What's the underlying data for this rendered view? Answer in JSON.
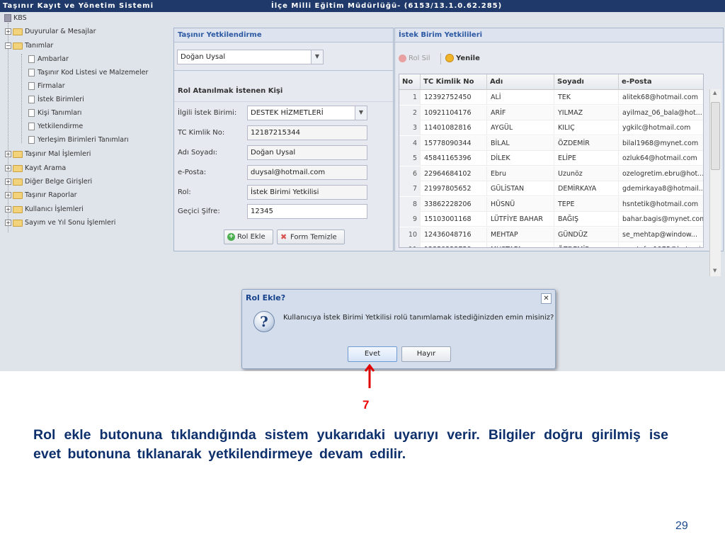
{
  "titlebar": {
    "left": "Taşınır Kayıt ve Yönetim Sistemi",
    "center": "İlçe Milli Eğitim Müdürlüğü- (6153/13.1.0.62.285)"
  },
  "tree": {
    "root": "KBS",
    "items": [
      {
        "label": "Duyurular & Mesajlar",
        "expanded": false
      },
      {
        "label": "Tanımlar",
        "expanded": true
      },
      {
        "label": "Ambarlar"
      },
      {
        "label": "Taşınır Kod Listesi ve Malzemeler"
      },
      {
        "label": "Firmalar"
      },
      {
        "label": "İstek Birimleri"
      },
      {
        "label": "Kişi Tanımları"
      },
      {
        "label": "Yetkilendirme"
      },
      {
        "label": "Yerleşim Birimleri Tanımları"
      },
      {
        "label": "Taşınır Mal İşlemleri",
        "expanded": false
      },
      {
        "label": "Kayıt Arama",
        "expanded": false
      },
      {
        "label": "Diğer Belge Girişleri",
        "expanded": false
      },
      {
        "label": "Taşınır Raporlar",
        "expanded": false
      },
      {
        "label": "Kullanıcı İşlemleri",
        "expanded": false
      },
      {
        "label": "Sayım ve Yıl Sonu İşlemleri",
        "expanded": false
      }
    ]
  },
  "left_panel": {
    "title": "Taşınır Yetkilendirme",
    "person_select": "Doğan Uysal",
    "section_title": "Rol Atanılmak İstenen Kişi",
    "fields": {
      "unit_label": "İlgili İstek Birimi:",
      "unit_value": "DESTEK HİZMETLERİ",
      "tc_label": "TC Kimlik No:",
      "tc_value": "12187215344",
      "name_label": "Adı Soyadı:",
      "name_value": "Doğan Uysal",
      "email_label": "e-Posta:",
      "email_value": "duysal@hotmail.com",
      "role_label": "Rol:",
      "role_value": "İstek Birimi Yetkilisi",
      "pass_label": "Geçici Şifre:",
      "pass_value": "12345"
    },
    "add_role_button": "Rol Ekle",
    "clear_form_button": "Form Temizle"
  },
  "right_panel": {
    "title": "İstek Birim Yetkilileri",
    "delete_role_button": "Rol Sil",
    "refresh_button": "Yenile",
    "columns": [
      "No",
      "TC Kimlik No",
      "Adı",
      "Soyadı",
      "e-Posta"
    ],
    "rows": [
      [
        "1",
        "12392752450",
        "ALİ",
        "TEK",
        "alitek68@hotmail.com"
      ],
      [
        "2",
        "10921104176",
        "ARİF",
        "YILMAZ",
        "ayilmaz_06_bala@hot..."
      ],
      [
        "3",
        "11401082816",
        "AYGÜL",
        "KILIÇ",
        "ygkilc@hotmail.com"
      ],
      [
        "4",
        "15778090344",
        "BİLAL",
        "ÖZDEMİR",
        "bilal1968@mynet.com"
      ],
      [
        "5",
        "45841165396",
        "DİLEK",
        "ELİPE",
        "ozluk64@hotmail.com"
      ],
      [
        "6",
        "22964684102",
        "Ebru",
        "Uzunöz",
        "ozelogretim.ebru@hot..."
      ],
      [
        "7",
        "21997805652",
        "GÜLİSTAN",
        "DEMİRKAYA",
        "gdemirkaya8@hotmail...."
      ],
      [
        "8",
        "33862228206",
        "HÜSNÜ",
        "TEPE",
        "hsntetik@hotmail.com"
      ],
      [
        "9",
        "15103001168",
        "LÜTFİYE BAHAR",
        "BAĞIŞ",
        "bahar.bagis@mynet.com"
      ],
      [
        "10",
        "12436048716",
        "MEHTAP",
        "GÜNDÜZ",
        "se_mehtap@window..."
      ],
      [
        "11",
        "12358223758",
        "MUSTAFA",
        "ÖZDEMİR",
        "mustafa_1975@hotmai..."
      ]
    ]
  },
  "dialog": {
    "title": "Rol Ekle?",
    "message": "Kullanıcıya İstek Birimi Yetkilisi rolü tanımlamak istediğinizden emin misiniz?",
    "yes_button": "Evet",
    "no_button": "Hayır",
    "close_symbol": "✕",
    "question_symbol": "?"
  },
  "annotation": {
    "step": "7",
    "caption": "Rol ekle butonuna tıklandığında sistem yukarıdaki uyarıyı verir. Bilgiler doğru girilmiş ise evet butonuna tıklanarak yetkilendirmeye devam edilir.",
    "page_number": "29",
    "arrow_color": "#e00000"
  },
  "colors": {
    "titlebar": "#1f3a6a",
    "panel_title": "#2d59a3",
    "caption": "#0d2f6b"
  }
}
